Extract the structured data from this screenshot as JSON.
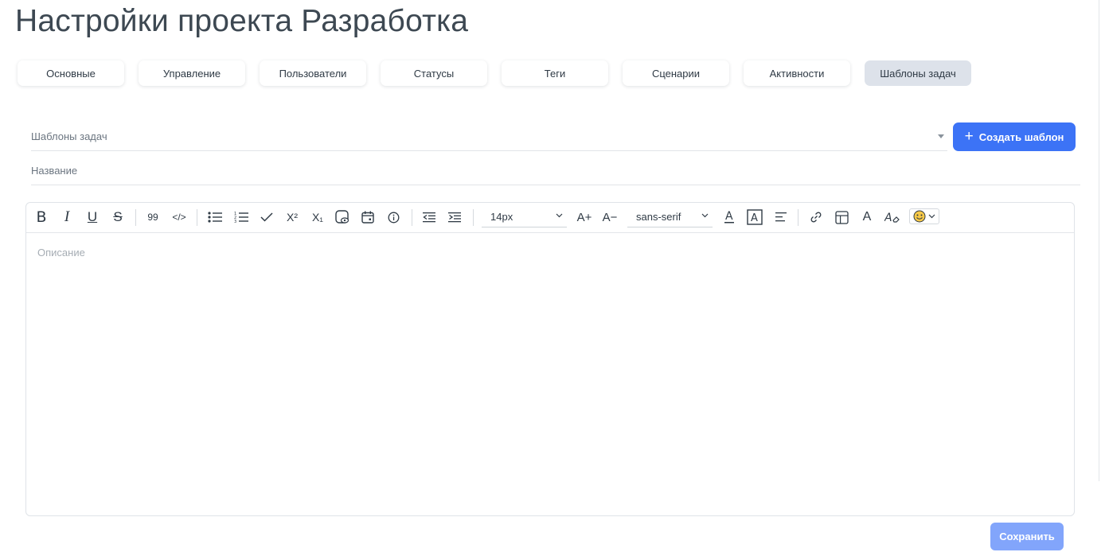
{
  "page": {
    "title": "Настройки проекта Разработка"
  },
  "tabs": [
    {
      "label": "Основные",
      "active": false
    },
    {
      "label": "Управление",
      "active": false
    },
    {
      "label": "Пользователи",
      "active": false
    },
    {
      "label": "Статусы",
      "active": false
    },
    {
      "label": "Теги",
      "active": false
    },
    {
      "label": "Сценарии",
      "active": false
    },
    {
      "label": "Активности",
      "active": false
    },
    {
      "label": "Шаблоны задач",
      "active": true
    }
  ],
  "form": {
    "templates_select": {
      "placeholder": "Шаблоны задач"
    },
    "name_field": {
      "placeholder": "Название"
    },
    "create_button": {
      "label": "Создать шаблон",
      "icon": "plus-icon"
    },
    "description": {
      "placeholder": "Описание"
    },
    "save_button": {
      "label": "Сохранить"
    }
  },
  "toolbar": {
    "font_size": "14px",
    "font_family": "sans-serif",
    "superscript_label": "X²",
    "subscript_label": "X₁",
    "increase_font_label": "A+",
    "decrease_font_label": "A−",
    "quote_label": "99",
    "code_label": "</>"
  },
  "colors": {
    "accent": "#3c73f6",
    "accent_disabled": "#82a5fb",
    "active_tab_bg": "#dde2ea",
    "text": "#2f3a45"
  }
}
